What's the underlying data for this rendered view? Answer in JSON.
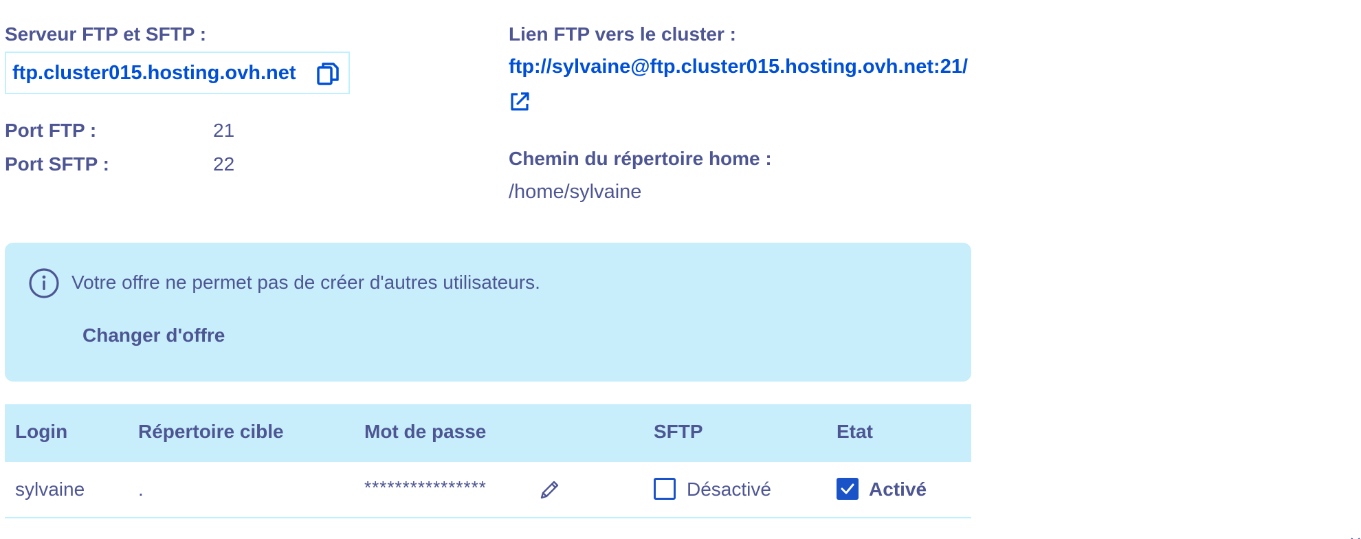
{
  "server": {
    "label": "Serveur FTP et SFTP :",
    "value": "ftp.cluster015.hosting.ovh.net",
    "copy_icon": "copy-icon"
  },
  "ports": {
    "ftp_label": "Port FTP :",
    "ftp_value": "21",
    "sftp_label": "Port SFTP :",
    "sftp_value": "22"
  },
  "cluster_link": {
    "label": "Lien FTP vers le cluster :",
    "url": "ftp://sylvaine@ftp.cluster015.hosting.ovh.net:21/",
    "icon": "external-link-icon"
  },
  "home_dir": {
    "label": "Chemin du répertoire home :",
    "value": "/home/sylvaine"
  },
  "banner": {
    "icon": "info-icon",
    "message": "Votre offre ne permet pas de créer d'autres utilisateurs.",
    "action_label": "Changer d'offre"
  },
  "table": {
    "headers": [
      "Login",
      "Répertoire cible",
      "Mot de passe",
      "SFTP",
      "Etat"
    ],
    "rows": [
      {
        "login": "sylvaine",
        "directory": ".",
        "password": "****************",
        "sftp": {
          "checked": false,
          "label": "Désactivé"
        },
        "etat": {
          "checked": true,
          "label": "Activé"
        }
      }
    ]
  },
  "colors": {
    "text": "#4d5693",
    "link": "#0050d7",
    "banner_bg": "#c8eefc",
    "border": "#bef1ff",
    "checkbox": "#1a52c7"
  }
}
